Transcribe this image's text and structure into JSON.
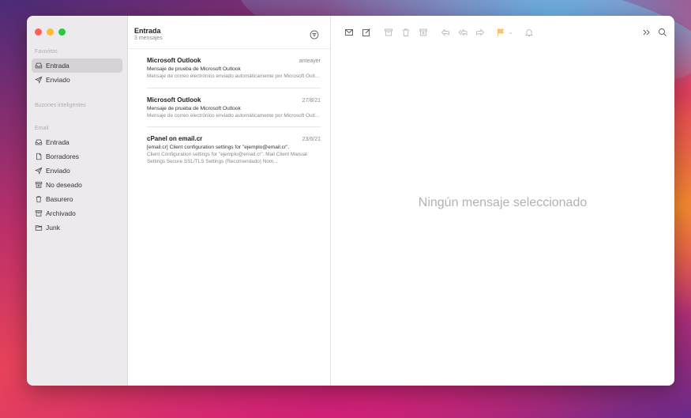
{
  "sidebar": {
    "sections": {
      "favorites": "Favoritos",
      "smart": "Buzones inteligentes",
      "email": "Email"
    },
    "favorites": [
      {
        "label": "Entrada",
        "icon": "inbox-icon",
        "selected": true
      },
      {
        "label": "Enviado",
        "icon": "sent-icon",
        "selected": false
      }
    ],
    "email": [
      {
        "label": "Entrada",
        "icon": "inbox-icon"
      },
      {
        "label": "Borradores",
        "icon": "drafts-icon"
      },
      {
        "label": "Enviado",
        "icon": "sent-icon"
      },
      {
        "label": "No deseado",
        "icon": "junk-icon"
      },
      {
        "label": "Basurero",
        "icon": "trash-icon"
      },
      {
        "label": "Archivado",
        "icon": "archive-icon"
      },
      {
        "label": "Junk",
        "icon": "folder-icon"
      }
    ]
  },
  "list": {
    "title": "Entrada",
    "count": "3 mensajes",
    "messages": [
      {
        "sender": "Microsoft Outlook",
        "date": "anteayer",
        "subject": "Mensaje de prueba de Microsoft Outlook",
        "preview": "Mensaje de correo electrónico enviado automáticamente por Microsoft Outlook"
      },
      {
        "sender": "Microsoft Outlook",
        "date": "27/8/21",
        "subject": "Mensaje de prueba de Microsoft Outlook",
        "preview": "Mensaje de correo electrónico enviado automáticamente por Microsoft Outlook"
      },
      {
        "sender": "cPanel on email.cr",
        "date": "23/6/21",
        "subject": "[email.cr] Client configuration settings for \"ejemplo@email.cr\".",
        "preview": "Client Configuration settings for \"ejemplo@email.cr\". Mail Client Manual Settings Secure SSL/TLS Settings (Recomendado) Nom..."
      }
    ]
  },
  "reader": {
    "empty_text": "Ningún mensaje seleccionado"
  },
  "colors": {
    "accent_flag": "#f5a623",
    "selected_bg": "#d5d3d6"
  }
}
